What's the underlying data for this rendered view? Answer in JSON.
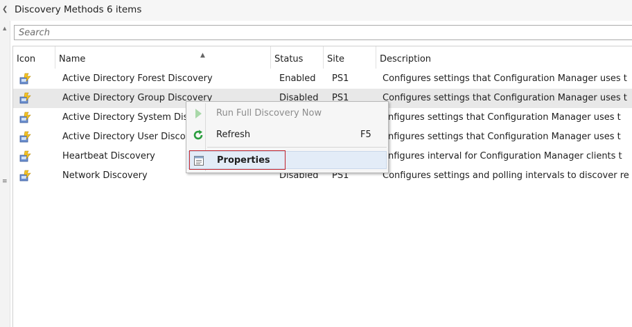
{
  "title": "Discovery Methods 6 items",
  "search": {
    "placeholder": "Search",
    "value": ""
  },
  "columns": [
    "Icon",
    "Name",
    "Status",
    "Site",
    "Description"
  ],
  "rows": [
    {
      "icon": "discovery-method-icon",
      "name": "Active Directory Forest Discovery",
      "status": "Enabled",
      "site": "PS1",
      "description": "Configures settings that Configuration Manager uses t"
    },
    {
      "icon": "discovery-method-icon",
      "name": "Active Directory Group Discovery",
      "status": "Disabled",
      "site": "PS1",
      "description": "Configures settings that Configuration Manager uses t"
    },
    {
      "icon": "discovery-method-icon",
      "name": "Active Directory System Dis",
      "status": "",
      "site": "",
      "description": "onfigures settings that Configuration Manager uses t"
    },
    {
      "icon": "discovery-method-icon",
      "name": "Active Directory User Disco",
      "status": "",
      "site": "",
      "description": "onfigures settings that Configuration Manager uses t"
    },
    {
      "icon": "discovery-method-icon",
      "name": "Heartbeat Discovery",
      "status": "",
      "site": "",
      "description": "onfigures interval for Configuration Manager clients t"
    },
    {
      "icon": "discovery-method-icon",
      "name": "Network Discovery",
      "status": "Disabled",
      "site": "PS1",
      "description": "Configures settings and polling intervals to discover re"
    }
  ],
  "context_menu": {
    "items": [
      {
        "label": "Run Full Discovery Now",
        "icon": "play-icon",
        "disabled": true,
        "shortcut": ""
      },
      {
        "label": "Refresh",
        "icon": "refresh-icon",
        "disabled": false,
        "shortcut": "F5"
      },
      {
        "label": "Properties",
        "icon": "properties-icon",
        "disabled": false,
        "shortcut": "",
        "highlighted": true
      }
    ]
  },
  "colors": {
    "selected_row": "#e8e8e8",
    "highlight_border": "#c0202a",
    "menu_background": "#f6f6f6",
    "refresh_green": "#2a9d3e"
  }
}
